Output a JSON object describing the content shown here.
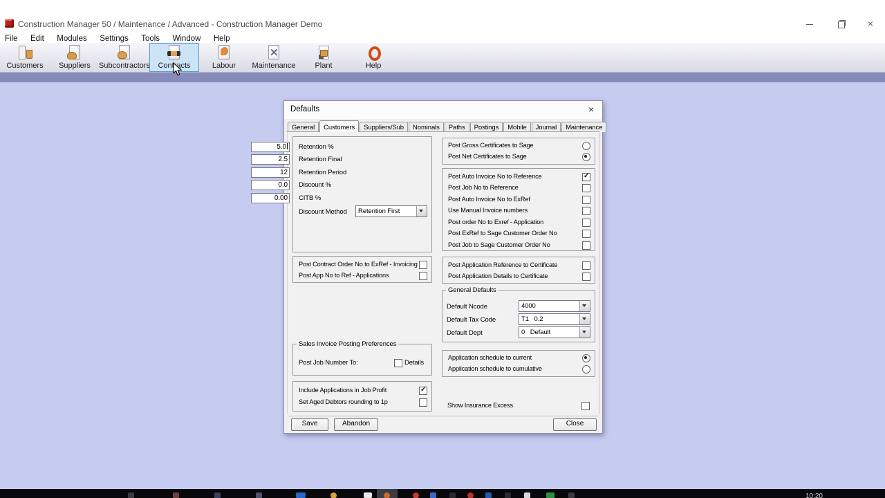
{
  "window": {
    "title": "Construction Manager 50 / Maintenance / Advanced  - Construction Manager Demo",
    "close_glyph": "×"
  },
  "menu": {
    "items": [
      "File",
      "Edit",
      "Modules",
      "Settings",
      "Tools",
      "Window",
      "Help"
    ]
  },
  "toolbar": {
    "active": "Contracts",
    "buttons": [
      {
        "label": "Customers",
        "icon": "customers-icon"
      },
      {
        "label": "Suppliers",
        "icon": "suppliers-icon"
      },
      {
        "label": "Subcontractors",
        "icon": "subcontractors-icon"
      },
      {
        "label": "Contracts",
        "icon": "contracts-icon"
      },
      {
        "label": "Labour",
        "icon": "labour-icon"
      },
      {
        "label": "Maintenance",
        "icon": "maintenance-icon"
      },
      {
        "label": "Plant",
        "icon": "plant-icon"
      },
      {
        "label": "Help",
        "icon": "help-icon"
      }
    ]
  },
  "dialog": {
    "title": "Defaults",
    "close_glyph": "×",
    "active_tab": "Customers",
    "tabs": [
      "General",
      "Customers",
      "Suppliers/Sub",
      "Nominals",
      "Paths",
      "Postings",
      "Mobile",
      "Journal",
      "Maintenance"
    ],
    "retention": {
      "fields": [
        {
          "label": "Retention %",
          "value": "5.0"
        },
        {
          "label": "Retention Final",
          "value": "2.5"
        },
        {
          "label": "Retention Period",
          "value": "12"
        },
        {
          "label": "Discount %",
          "value": "0.0"
        },
        {
          "label": "CITB %",
          "value": "0.00"
        }
      ],
      "discount_method": {
        "label": "Discount Method",
        "value": "Retention First"
      }
    },
    "invoicing_options": [
      {
        "label": "Post Contract Order No to ExRef - Invoicing",
        "checked": false
      },
      {
        "label": "Post App No to Ref - Applications",
        "checked": false
      }
    ],
    "sales_invoice": {
      "title": "Sales Invoice Posting Preferences",
      "post_job_label": "Post Job Number To:",
      "details_label": "Details",
      "details_checked": false
    },
    "job_profit_options": [
      {
        "label": "Include Applications in Job Profit",
        "checked": true
      },
      {
        "label": "Set Aged Debtors rounding to 1p",
        "checked": false
      }
    ],
    "certificate_radios": [
      {
        "label": "Post Gross Certificates to Sage",
        "selected": false
      },
      {
        "label": "Post Net Certificates to Sage",
        "selected": true
      }
    ],
    "posting_options": [
      {
        "label": "Post Auto Invoice No to Reference",
        "checked": true
      },
      {
        "label": "Post Job No to Reference",
        "checked": false
      },
      {
        "label": "Post Auto Invoice No to ExRef",
        "checked": false
      },
      {
        "label": "Use Manual Invoice numbers",
        "checked": false
      },
      {
        "label": "Post order No to Exref - Application",
        "checked": false
      },
      {
        "label": "Post ExRef to Sage Customer Order No",
        "checked": false
      },
      {
        "label": "Post Job to Sage Customer Order No",
        "checked": false
      }
    ],
    "certificate_options": [
      {
        "label": "Post Application Reference to Certificate",
        "checked": false
      },
      {
        "label": "Post Application Details to Certificate",
        "checked": false
      }
    ],
    "general_defaults": {
      "title": "General Defaults",
      "fields": [
        {
          "label": "Default Ncode",
          "value": "4000"
        },
        {
          "label": "Default Tax Code",
          "value": "T1   0.2"
        },
        {
          "label": "Default Dept",
          "value": "0   Default"
        }
      ]
    },
    "schedule_radios": [
      {
        "label": "Application schedule to current",
        "selected": true
      },
      {
        "label": "Application schedule to cumulative",
        "selected": false
      }
    ],
    "insurance": {
      "label": "Show Insurance Excess",
      "checked": false
    },
    "buttons": {
      "save": "Save",
      "abandon": "Abandon",
      "close": "Close"
    }
  },
  "taskbar": {
    "clock": "10:20"
  },
  "colors": {
    "client_bg": "#c6cbf0",
    "header_strip": "#868bba",
    "toolbar_active_bg": "#cde4f7",
    "toolbar_active_border": "#569ad3",
    "dialog_bg": "#f1f1f1",
    "taskbar_bg": "#08080a"
  }
}
